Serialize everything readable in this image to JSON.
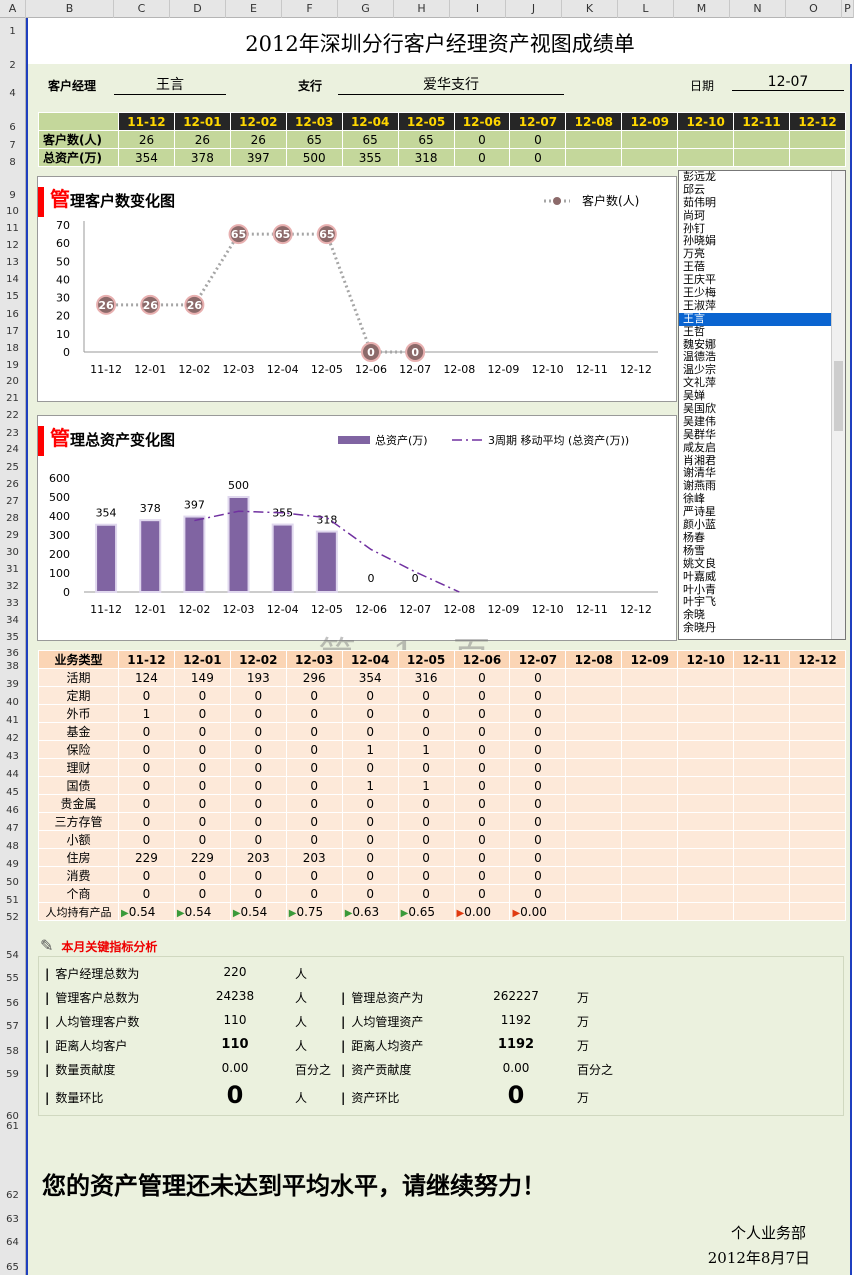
{
  "columns": [
    "A",
    "B",
    "C",
    "D",
    "E",
    "F",
    "G",
    "H",
    "I",
    "J",
    "K",
    "L",
    "M",
    "N",
    "O",
    "P"
  ],
  "rows": [
    "1",
    "2",
    "4",
    "6",
    "7",
    "8",
    "9",
    "10",
    "11",
    "12",
    "13",
    "14",
    "15",
    "16",
    "17",
    "18",
    "19",
    "20",
    "21",
    "22",
    "23",
    "24",
    "25",
    "26",
    "27",
    "28",
    "29",
    "30",
    "31",
    "32",
    "33",
    "34",
    "35",
    "36",
    "38",
    "39",
    "40",
    "41",
    "42",
    "43",
    "44",
    "45",
    "46",
    "47",
    "48",
    "49",
    "50",
    "51",
    "52",
    "54",
    "55",
    "56",
    "57",
    "58",
    "59",
    "60",
    "61",
    "62",
    "63",
    "64",
    "65"
  ],
  "title": "2012年深圳分行客户经理资产视图成绩单",
  "header": {
    "manager_label": "客户经理",
    "manager_value": "王言",
    "branch_label": "支行",
    "branch_value": "爱华支行",
    "date_label": "日期",
    "date_value": "12-07"
  },
  "months": [
    "11-12",
    "12-01",
    "12-02",
    "12-03",
    "12-04",
    "12-05",
    "12-06",
    "12-07",
    "12-08",
    "12-09",
    "12-10",
    "12-11",
    "12-12"
  ],
  "summary": {
    "rows": [
      {
        "label": "客户数(人)",
        "values": [
          "26",
          "26",
          "26",
          "65",
          "65",
          "65",
          "0",
          "0",
          "",
          "",
          "",
          "",
          ""
        ]
      },
      {
        "label": "总资产(万)",
        "values": [
          "354",
          "378",
          "397",
          "500",
          "355",
          "318",
          "0",
          "0",
          "",
          "",
          "",
          "",
          ""
        ]
      }
    ]
  },
  "chart1": {
    "title_first": "管",
    "title_rest": "理客户数变化图",
    "legend": "客户数(人)",
    "color": "#a58c8c"
  },
  "chart2": {
    "title_first": "管",
    "title_rest": "理总资产变化图",
    "legend_bar": "总资产(万)",
    "legend_line": "3周期 移动平均 (总资产(万))",
    "bar_color": "#8064a2",
    "line_color": "#7030a0"
  },
  "chart_data": [
    {
      "type": "line",
      "x": [
        "11-12",
        "12-01",
        "12-02",
        "12-03",
        "12-04",
        "12-05",
        "12-06",
        "12-07",
        "12-08",
        "12-09",
        "12-10",
        "12-11",
        "12-12"
      ],
      "series": [
        {
          "name": "客户数(人)",
          "values": [
            26,
            26,
            26,
            65,
            65,
            65,
            0,
            0,
            null,
            null,
            null,
            null,
            null
          ]
        }
      ],
      "ylim": [
        0,
        70
      ],
      "yticks": [
        0,
        10,
        20,
        30,
        40,
        50,
        60,
        70
      ],
      "title": "理客户数变化图",
      "legend": "top-right",
      "grid": false
    },
    {
      "type": "bar",
      "categories": [
        "11-12",
        "12-01",
        "12-02",
        "12-03",
        "12-04",
        "12-05",
        "12-06",
        "12-07",
        "12-08",
        "12-09",
        "12-10",
        "12-11",
        "12-12"
      ],
      "series": [
        {
          "name": "总资产(万)",
          "values": [
            354,
            378,
            397,
            500,
            355,
            318,
            0,
            0,
            null,
            null,
            null,
            null,
            null
          ]
        },
        {
          "name": "3周期 移动平均 (总资产(万))",
          "values": [
            null,
            null,
            376,
            425,
            417,
            391,
            224,
            106,
            0,
            null,
            null,
            null,
            null
          ]
        }
      ],
      "ylim": [
        0,
        600
      ],
      "yticks": [
        0,
        100,
        200,
        300,
        400,
        500,
        600
      ],
      "title": "理总资产变化图",
      "legend": "top-right",
      "grid": false
    }
  ],
  "managers": [
    "彭远龙",
    "邱云",
    "茹伟明",
    "尚珂",
    "孙钉",
    "孙晓娟",
    "万亮",
    "王蓓",
    "王庆平",
    "王少梅",
    "王淑萍",
    "王言",
    "王哲",
    "魏安娜",
    "温德浩",
    "温少宗",
    "文礼萍",
    "吴婵",
    "吴国欣",
    "吴建伟",
    "吴群华",
    "咸友启",
    "肖湘君",
    "谢清华",
    "谢燕雨",
    "徐峰",
    "严诗星",
    "颜小蓝",
    "杨春",
    "杨雪",
    "姚文良",
    "叶嘉威",
    "叶小青",
    "叶宇飞",
    "余晓",
    "余晓丹"
  ],
  "selected_manager": "王言",
  "watermark": "第 1 页",
  "business": {
    "header": "业务类型",
    "rows": [
      {
        "label": "活期",
        "values": [
          "124",
          "149",
          "193",
          "296",
          "354",
          "316",
          "0",
          "0"
        ]
      },
      {
        "label": "定期",
        "values": [
          "0",
          "0",
          "0",
          "0",
          "0",
          "0",
          "0",
          "0"
        ]
      },
      {
        "label": "外币",
        "values": [
          "1",
          "0",
          "0",
          "0",
          "0",
          "0",
          "0",
          "0"
        ]
      },
      {
        "label": "基金",
        "values": [
          "0",
          "0",
          "0",
          "0",
          "0",
          "0",
          "0",
          "0"
        ]
      },
      {
        "label": "保险",
        "values": [
          "0",
          "0",
          "0",
          "0",
          "1",
          "1",
          "0",
          "0"
        ]
      },
      {
        "label": "理财",
        "values": [
          "0",
          "0",
          "0",
          "0",
          "0",
          "0",
          "0",
          "0"
        ]
      },
      {
        "label": "国债",
        "values": [
          "0",
          "0",
          "0",
          "0",
          "1",
          "1",
          "0",
          "0"
        ]
      },
      {
        "label": "贵金属",
        "values": [
          "0",
          "0",
          "0",
          "0",
          "0",
          "0",
          "0",
          "0"
        ]
      },
      {
        "label": "三方存管",
        "values": [
          "0",
          "0",
          "0",
          "0",
          "0",
          "0",
          "0",
          "0"
        ]
      },
      {
        "label": "小额",
        "values": [
          "0",
          "0",
          "0",
          "0",
          "0",
          "0",
          "0",
          "0"
        ]
      },
      {
        "label": "住房",
        "values": [
          "229",
          "229",
          "203",
          "203",
          "0",
          "0",
          "0",
          "0"
        ]
      },
      {
        "label": "消费",
        "values": [
          "0",
          "0",
          "0",
          "0",
          "0",
          "0",
          "0",
          "0"
        ]
      },
      {
        "label": "个商",
        "values": [
          "0",
          "0",
          "0",
          "0",
          "0",
          "0",
          "0",
          "0"
        ]
      }
    ],
    "per_capita_label": "人均持有产品",
    "per_capita": [
      {
        "v": "0.54",
        "flag": "green"
      },
      {
        "v": "0.54",
        "flag": "green"
      },
      {
        "v": "0.54",
        "flag": "green"
      },
      {
        "v": "0.75",
        "flag": "green"
      },
      {
        "v": "0.63",
        "flag": "green"
      },
      {
        "v": "0.65",
        "flag": "green"
      },
      {
        "v": "0.00",
        "flag": "red"
      },
      {
        "v": "0.00",
        "flag": "red"
      }
    ]
  },
  "kpi": {
    "heading": "本月关键指标分析",
    "left": [
      {
        "label": "客户经理总数为",
        "value": "220",
        "unit": "人"
      },
      {
        "label": "管理客户总数为",
        "value": "24238",
        "unit": "人"
      },
      {
        "label": "人均管理客户数",
        "value": "110",
        "unit": "人"
      },
      {
        "label": "距离人均客户",
        "value": "110",
        "unit": "人"
      },
      {
        "label": "数量贡献度",
        "value": "0.00",
        "unit": "百分之"
      },
      {
        "label": "数量环比",
        "value": "0",
        "unit": "人"
      }
    ],
    "right": [
      {
        "label": "管理总资产为",
        "value": "262227",
        "unit": "万"
      },
      {
        "label": "人均管理资产",
        "value": "1192",
        "unit": "万"
      },
      {
        "label": "距离人均资产",
        "value": "1192",
        "unit": "万"
      },
      {
        "label": "资产贡献度",
        "value": "0.00",
        "unit": "百分之"
      },
      {
        "label": "资产环比",
        "value": "0",
        "unit": "万"
      }
    ]
  },
  "message": "您的资产管理还未达到平均水平，请继续努力！",
  "dept": "个人业务部",
  "report_date": "2012年8月7日"
}
